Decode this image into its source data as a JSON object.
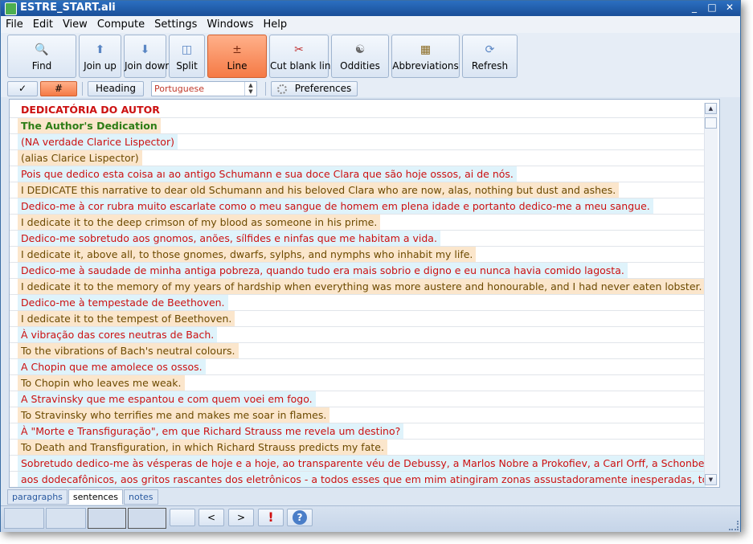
{
  "window": {
    "title": "ESTRE_START.ali",
    "controls": [
      "_",
      "□",
      "✕"
    ]
  },
  "menu": [
    "File",
    "Edit",
    "View",
    "Compute",
    "Settings",
    "Windows",
    "Help"
  ],
  "toolbar": {
    "find": "Find",
    "join_up": "Join up",
    "join_down": "Join down",
    "split": "Split",
    "line": "Line",
    "cut_blank": "Cut blank lines",
    "oddities": "Oddities",
    "abbreviations": "Abbreviations",
    "refresh": "Refresh"
  },
  "options": {
    "check": "✓",
    "hash": "#",
    "heading": "Heading",
    "language": "Portuguese",
    "preferences": "Preferences"
  },
  "rows": [
    {
      "kind": "h-pt",
      "text": "DEDICATÓRIA DO AUTOR"
    },
    {
      "kind": "h-en",
      "text": "The Author's Dedication"
    },
    {
      "kind": "pt",
      "text": "(NA verdade Clarice Lispector)"
    },
    {
      "kind": "en",
      "text": "(alias Clarice Lispector)"
    },
    {
      "kind": "pt",
      "text": "Pois que dedico esta coisa aı ao antigo Schumann e sua doce Clara que são hoje ossos, ai de nós."
    },
    {
      "kind": "en",
      "text": "I DEDICATE this narrative to dear old Schumann and his beloved Clara who are now, alas, nothing but dust and ashes."
    },
    {
      "kind": "pt",
      "text": "Dedico-me à cor rubra muito escarlate como o meu sangue de homem em plena idade e portanto dedico-me a meu sangue."
    },
    {
      "kind": "en",
      "text": "I dedicate it to the deep crimson of my blood as someone in his prime."
    },
    {
      "kind": "pt",
      "text": "Dedico-me sobretudo aos gnomos, anões, sílfides e ninfas que me habitam a vida."
    },
    {
      "kind": "en",
      "text": "I dedicate it, above all, to those gnomes, dwarfs, sylphs, and nymphs who inhabit my life."
    },
    {
      "kind": "pt",
      "text": "Dedico-me à saudade de minha antiga pobreza, quando tudo era mais sobrio e digno e eu nunca havia comido lagosta."
    },
    {
      "kind": "en",
      "text": "I dedicate it to the memory of my years of hardship when everything was more austere and honourable, and I had never eaten lobster."
    },
    {
      "kind": "pt",
      "text": "Dedico-me à tempestade de Beethoven."
    },
    {
      "kind": "en",
      "text": "I dedicate it to the tempest of Beethoven."
    },
    {
      "kind": "pt",
      "text": "À vibração das cores neutras de Bach."
    },
    {
      "kind": "en",
      "text": "To the vibrations of Bach's neutral colours."
    },
    {
      "kind": "pt",
      "text": "A Chopin que me amolece os ossos."
    },
    {
      "kind": "en",
      "text": "To Chopin who leaves me weak."
    },
    {
      "kind": "pt",
      "text": "A Stravinsky que me espantou e com quem voei em fogo."
    },
    {
      "kind": "en",
      "text": "To Stravinsky who terrifies me and makes me soar in flames."
    },
    {
      "kind": "pt",
      "text": "À \"Morte e Transfiguração\", em que Richard Strauss me revela um destino?"
    },
    {
      "kind": "en",
      "text": "To Death and Transfiguration, in which Richard Strauss predicts my fate."
    },
    {
      "kind": "pt",
      "text": "Sobretudo dedico-me às vésperas de hoje e a hoje, ao transparente véu de Debussy, a Marlos Nobre a Prokofiev, a Carl Orff, a Schonberg,"
    },
    {
      "kind": "pt",
      "text": "aos dodecafônicos, aos gritos rascantes dos eletrônicos - a todos esses que em mim atingiram zonas assustadoramente inesperadas, todos"
    }
  ],
  "tabs": [
    "paragraphs",
    "sentences",
    "notes"
  ],
  "status": {
    "prev": "<",
    "next": ">",
    "alert": "!",
    "help": "?"
  }
}
